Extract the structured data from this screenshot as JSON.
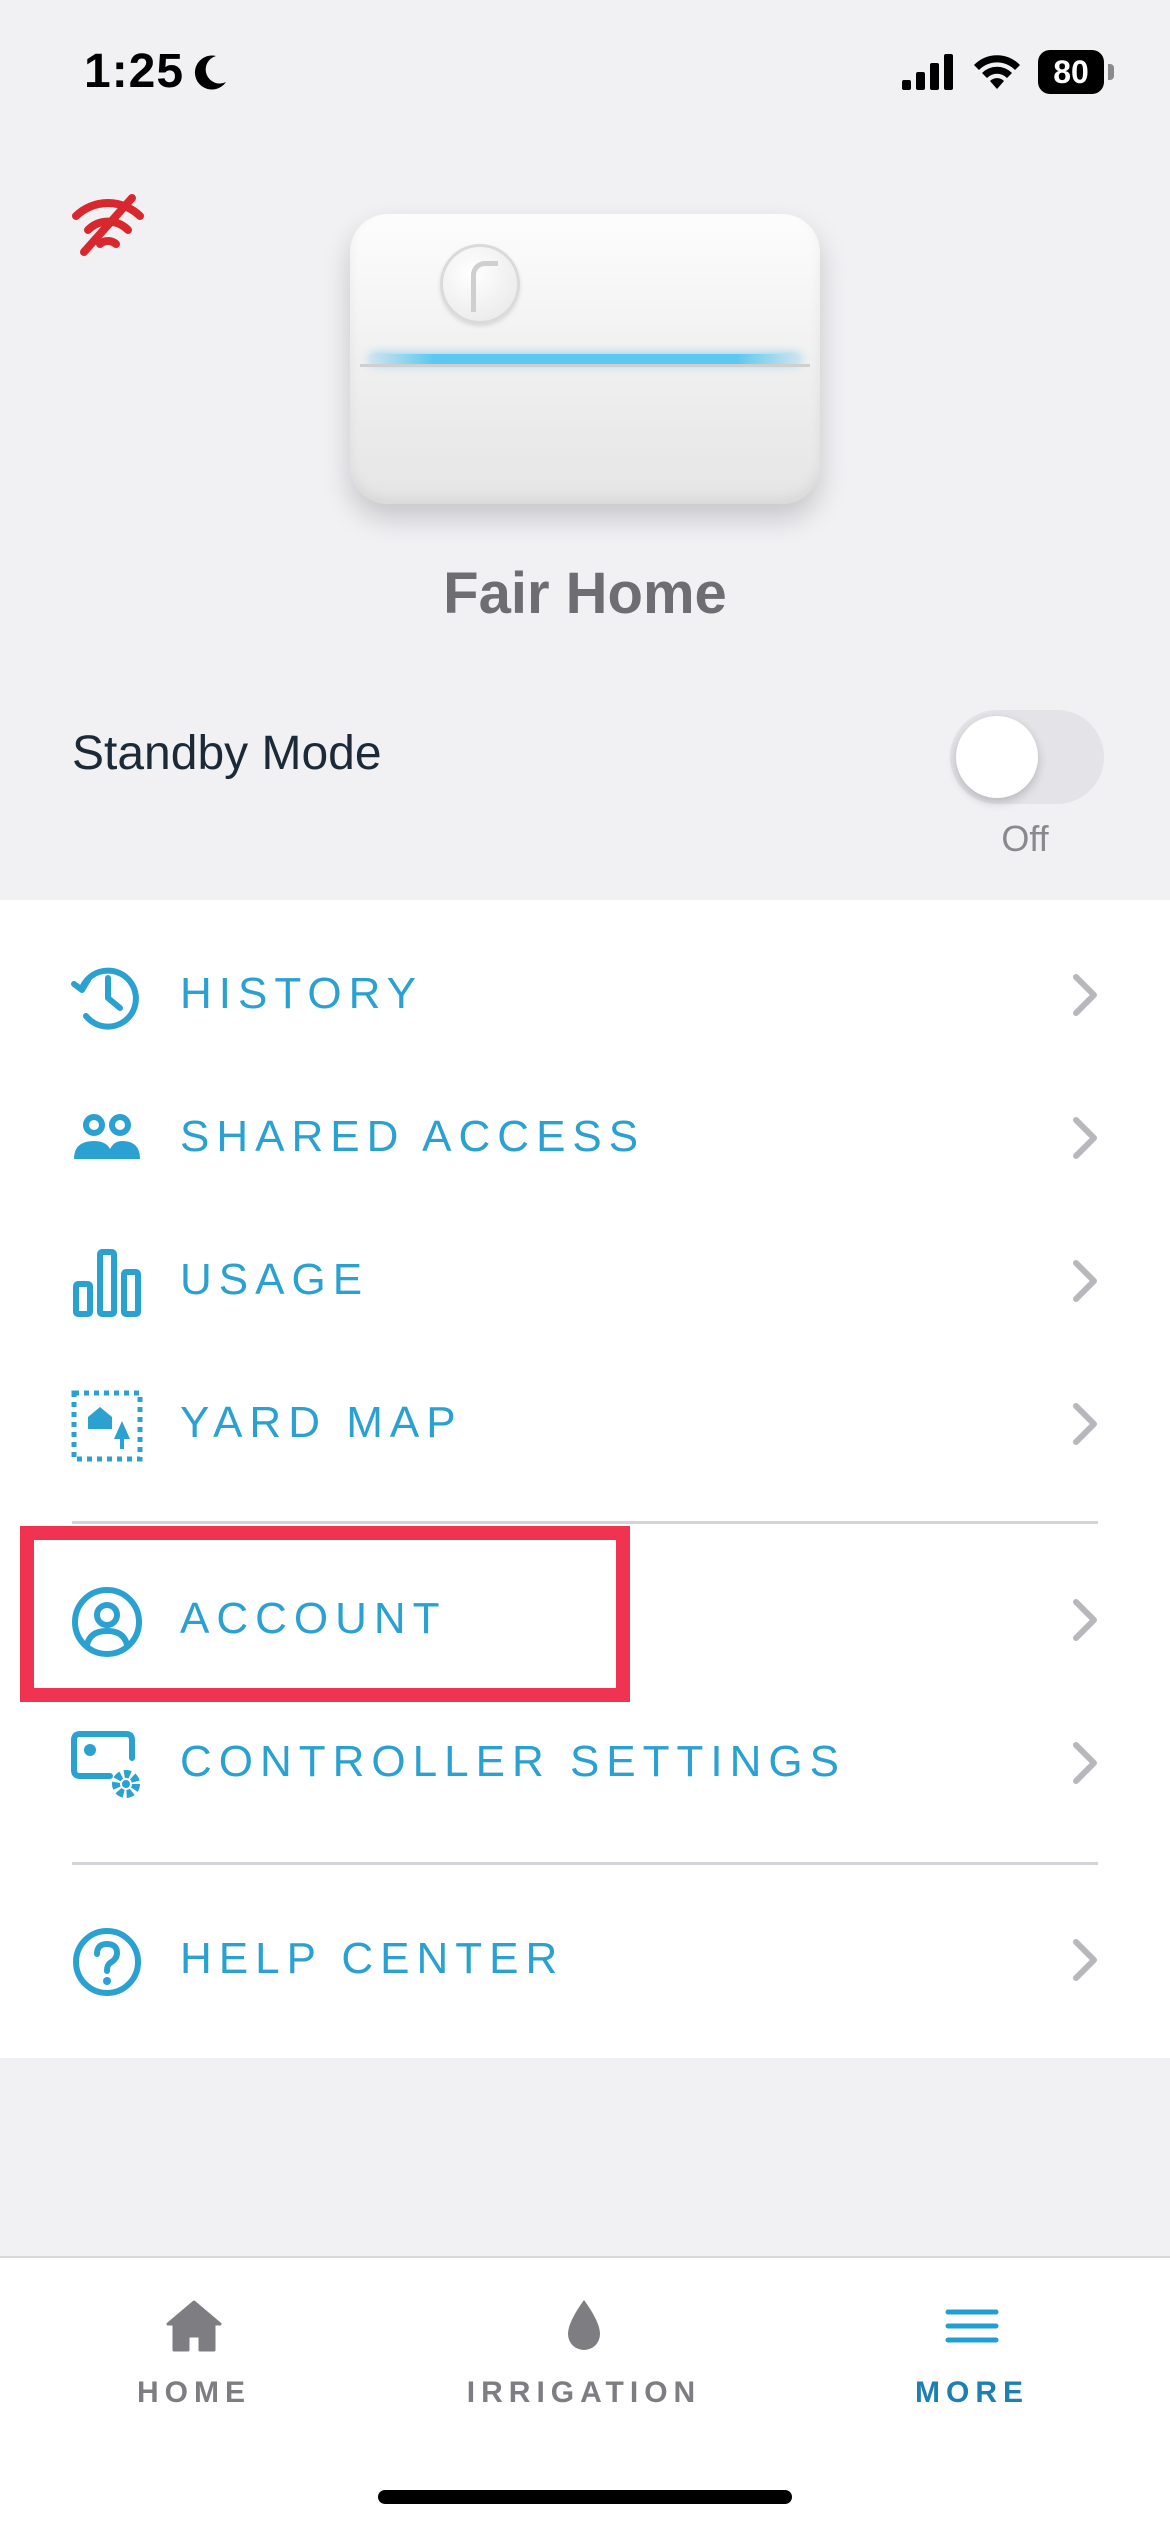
{
  "status_bar": {
    "time": "1:25",
    "battery": "80"
  },
  "controller": {
    "name": "Fair Home"
  },
  "standby": {
    "label": "Standby Mode",
    "state": "Off",
    "enabled": false
  },
  "menu": {
    "items": [
      {
        "label": "HISTORY",
        "icon": "history-icon"
      },
      {
        "label": "SHARED ACCESS",
        "icon": "people-icon"
      },
      {
        "label": "USAGE",
        "icon": "bar-chart-icon"
      },
      {
        "label": "YARD MAP",
        "icon": "yard-map-icon"
      },
      {
        "label": "ACCOUNT",
        "icon": "user-circle-icon"
      },
      {
        "label": "CONTROLLER SETTINGS",
        "icon": "controller-gear-icon"
      },
      {
        "label": "HELP CENTER",
        "icon": "question-circle-icon"
      }
    ]
  },
  "tabs": [
    {
      "label": "HOME",
      "icon": "house-icon",
      "active": false
    },
    {
      "label": "IRRIGATION",
      "icon": "water-drop-icon",
      "active": false
    },
    {
      "label": "MORE",
      "icon": "hamburger-menu-icon",
      "active": true
    }
  ],
  "colors": {
    "accent": "#2aa1d0",
    "highlight": "#ef3351",
    "wifi_off": "#d9272e",
    "active_tab": "#1f7fb0"
  }
}
